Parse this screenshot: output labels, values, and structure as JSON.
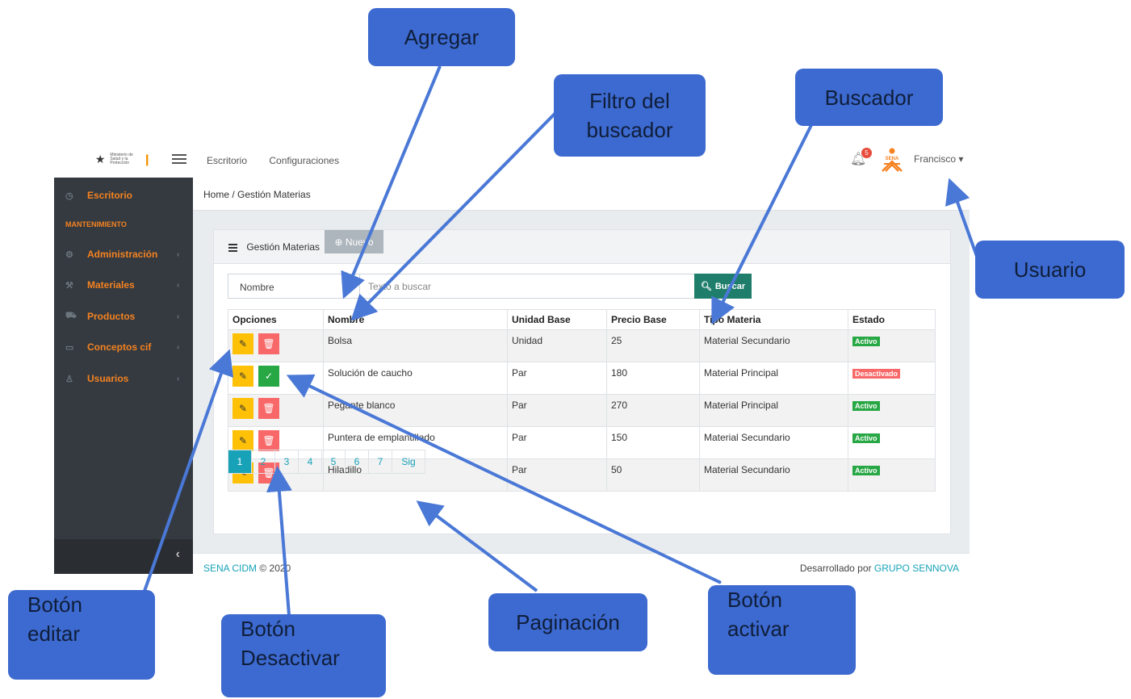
{
  "topbar": {
    "logo_text": "Ministerio de Salud y la Protección",
    "nav": [
      "Escritorio",
      "Configuraciones"
    ],
    "notification_count": "5",
    "brand_logo": "SENA",
    "user_label": "Francisco ▾"
  },
  "sidebar": {
    "section_header": "MANTENIMIENTO",
    "items": [
      {
        "label": "Escritorio",
        "icon": "dashboard-icon"
      },
      {
        "label": "Administración",
        "icon": "gear-icon"
      },
      {
        "label": "Materiales",
        "icon": "wrench-icon"
      },
      {
        "label": "Productos",
        "icon": "cart-icon"
      },
      {
        "label": "Conceptos cif",
        "icon": "folder-icon"
      },
      {
        "label": "Usuarios",
        "icon": "user-icon"
      }
    ],
    "collapse_icon": "chevron-left-icon"
  },
  "breadcrumb": {
    "home": "Home",
    "current": "Gestión Materias",
    "text": "Home  /  Gestión Materias"
  },
  "card": {
    "title": "Gestión Materias",
    "new_button": "⊕ Nuevo"
  },
  "search": {
    "filter_value": "Nombre",
    "placeholder": "Texto a buscar",
    "button": "Buscar"
  },
  "table": {
    "headers": [
      "Opciones",
      "Nombre",
      "Unidad Base",
      "Precio Base",
      "Tipo Materia",
      "Estado"
    ],
    "rows": [
      {
        "nombre": "Bolsa",
        "unidad": "Unidad",
        "precio": "25",
        "tipo": "Material Secundario",
        "estado": "Activo"
      },
      {
        "nombre": "Solución de caucho",
        "unidad": "Par",
        "precio": "180",
        "tipo": "Material Principal",
        "estado": "Desactivado"
      },
      {
        "nombre": "Pegante blanco",
        "unidad": "Par",
        "precio": "270",
        "tipo": "Material Principal",
        "estado": "Activo"
      },
      {
        "nombre": "Puntera de emplantillado",
        "unidad": "Par",
        "precio": "150",
        "tipo": "Material Secundario",
        "estado": "Activo"
      },
      {
        "nombre": "Hiladillo",
        "unidad": "Par",
        "precio": "50",
        "tipo": "Material Secundario",
        "estado": "Activo"
      }
    ]
  },
  "pagination": {
    "pages": [
      "1",
      "2",
      "3",
      "4",
      "5",
      "6",
      "7"
    ],
    "next": "Sig",
    "current": "1"
  },
  "footer": {
    "left_link": "SENA CIDM",
    "left_text": " © 2020",
    "right_text": "Desarrollado por ",
    "right_link": "GRUPO SENNOVA"
  },
  "callouts": {
    "agregar": "Agregar",
    "filtro_line1": "Filtro del",
    "filtro_line2": "buscador",
    "buscador": "Buscador",
    "usuario": "Usuario",
    "editar_line1": "Botón",
    "editar_line2": "editar",
    "desactivar_line1": "Botón",
    "desactivar_line2": "Desactivar",
    "paginacion": "Paginación",
    "activar_line1": "Botón",
    "activar_line2": "activar"
  },
  "colors": {
    "accent_orange": "#f58220",
    "sidebar_bg": "#343a40",
    "callout_blue": "#3d6ad0",
    "arrow_blue": "#4a78d6",
    "search_green": "#1e7e6b",
    "page_teal": "#17a2b8"
  }
}
